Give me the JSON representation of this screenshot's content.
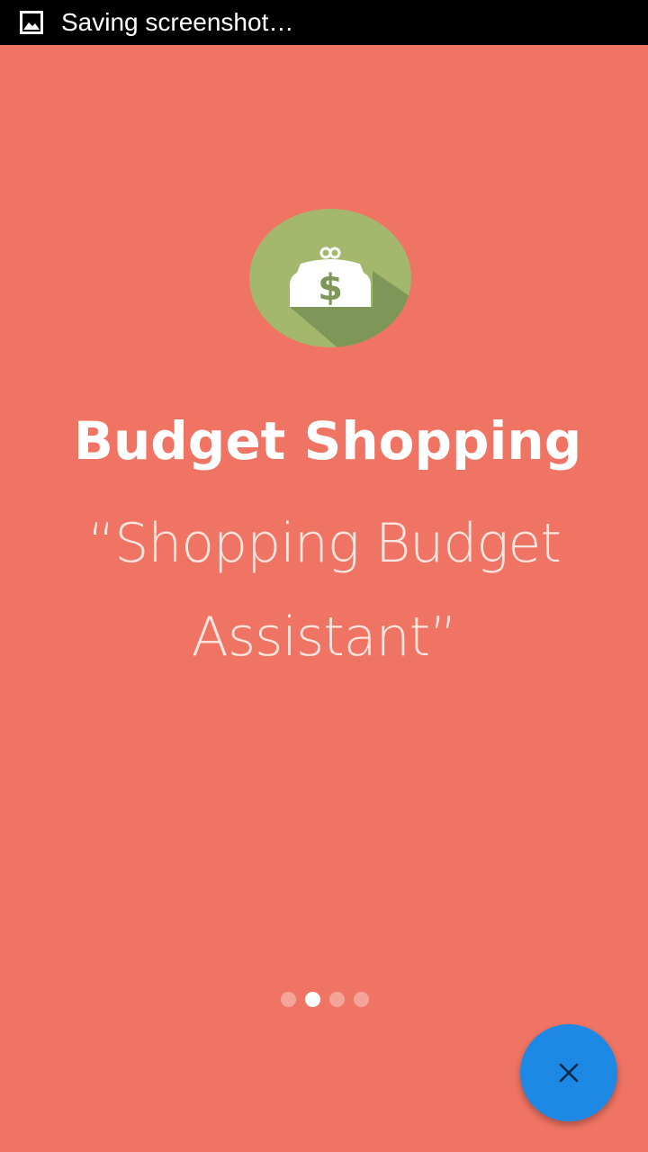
{
  "status_bar": {
    "notification_icon": "image-icon",
    "text": "Saving screenshot…"
  },
  "intro": {
    "logo_icon": "money-bag-icon",
    "title": "Budget Shopping",
    "subtitle": "“Shopping Budget Assistant”",
    "page_indicator": {
      "total_pages": 4,
      "current_page": 2
    }
  },
  "fab": {
    "icon": "close-icon"
  },
  "colors": {
    "background": "#F07463",
    "logo_circle": "#A3B86C",
    "logo_shadow": "#7E9657",
    "fab": "#1E88E5",
    "status_bar": "#000000"
  }
}
